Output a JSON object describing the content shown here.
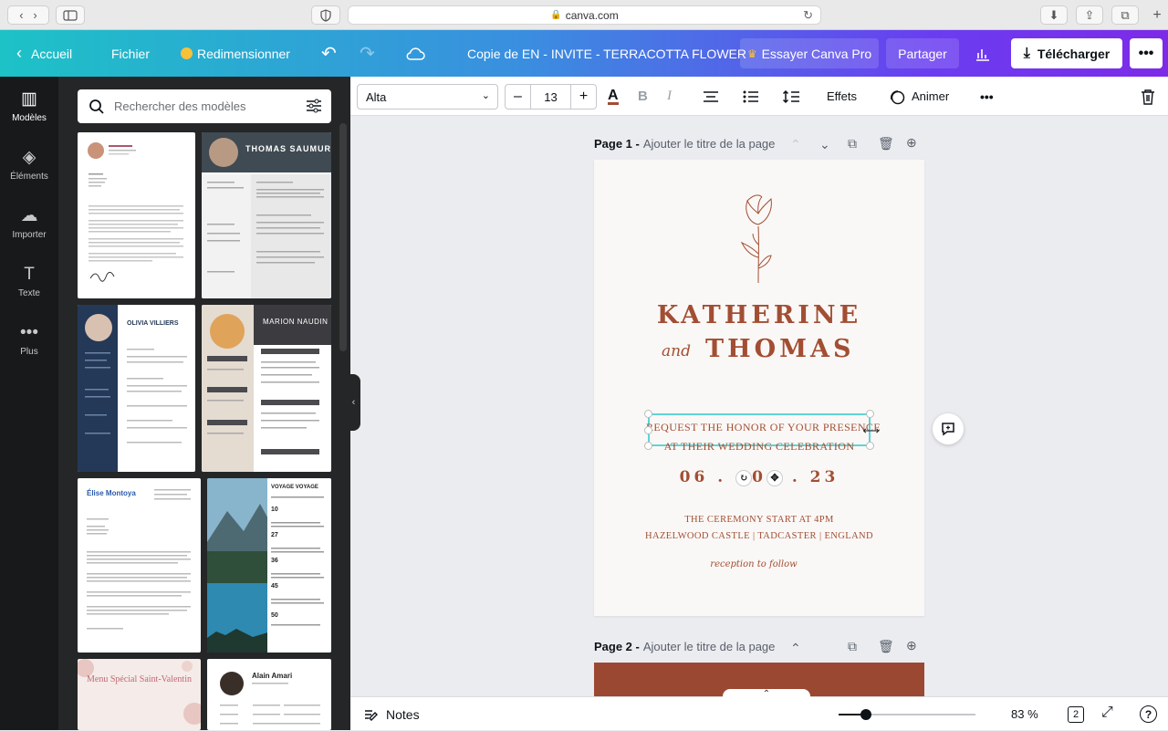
{
  "browser": {
    "url": "canva.com"
  },
  "header": {
    "home": "Accueil",
    "file": "Fichier",
    "resize": "Redimensionner",
    "doc_title": "Copie de  EN - INVITE - TERRACOTTA FLOWER",
    "try_pro": "Essayer Canva Pro",
    "share": "Partager",
    "download": "Télécharger"
  },
  "rail": [
    {
      "label": "Modèles",
      "icon": "templates-icon"
    },
    {
      "label": "Éléments",
      "icon": "elements-icon"
    },
    {
      "label": "Importer",
      "icon": "upload-icon"
    },
    {
      "label": "Texte",
      "icon": "text-icon"
    },
    {
      "label": "Plus",
      "icon": "more-icon"
    }
  ],
  "panel": {
    "search_placeholder": "Rechercher des modèles",
    "thumbs": [
      {
        "name": ""
      },
      {
        "name": "THOMAS SAUMUR"
      },
      {
        "name": "OLIVIA VILLIERS"
      },
      {
        "name": "MARION NAUDIN"
      },
      {
        "name": "Élise Montoya"
      },
      {
        "name": "VOYAGE VOYAGE"
      },
      {
        "name": "Menu Spécial Saint-Valentin"
      },
      {
        "name": "Alain Amari"
      }
    ]
  },
  "toolbar": {
    "font": "Alta",
    "size": "13",
    "effects": "Effets",
    "animate": "Animer"
  },
  "page1": {
    "label": "Page 1 -",
    "title_placeholder": "Ajouter le titre de la page",
    "name1": "KATHERINE",
    "and": "and",
    "name2": "THOMAS",
    "request_line1": "REQUEST THE HONOR OF YOUR PRESENCE",
    "request_line2": "AT THEIR WEDDING CELEBRATION",
    "date_a": "06 .",
    "date_b": "0",
    "date_c": ". 23",
    "ceremony": "THE CEREMONY START AT 4PM",
    "location": "HAZELWOOD CASTLE | TADCASTER | ENGLAND",
    "reception": "reception to follow"
  },
  "page2": {
    "label": "Page 2 -",
    "title_placeholder": "Ajouter le titre de la page"
  },
  "footer": {
    "notes": "Notes",
    "zoom": "83 %",
    "pages": "2",
    "zoom_level": 0.2
  },
  "colors": {
    "accent": "#a24e33",
    "selection": "#5fd3d6"
  }
}
